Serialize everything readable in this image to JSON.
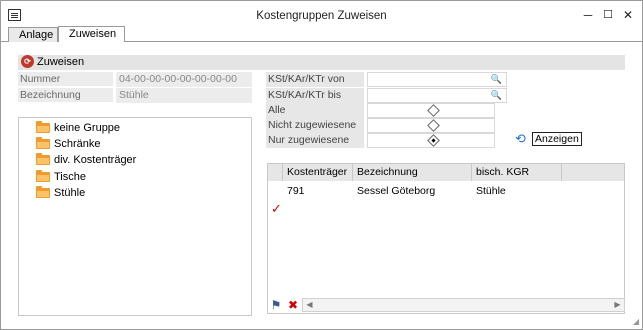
{
  "window": {
    "title": "Kostengruppen Zuweisen",
    "minimize": "─",
    "maximize": "☐",
    "close": "✕"
  },
  "tabs": [
    {
      "label": "Anlage"
    },
    {
      "label": "Zuweisen"
    }
  ],
  "header": {
    "label": "Zuweisen",
    "icon": "refresh-badge-icon"
  },
  "fields": {
    "nummer_label": "Nummer",
    "nummer_value": "04-00-00-00-00-00-00-00",
    "bezeichnung_label": "Bezeichnung",
    "bezeichnung_value": "Stühle"
  },
  "filters": {
    "von_label": "KSt/KAr/KTr von",
    "bis_label": "KSt/KAr/KTr bis",
    "alle_label": "Alle",
    "nicht_label": "Nicht zugewiesene",
    "nur_label": "Nur zugewiesene",
    "selected": "nur"
  },
  "tree": {
    "items": [
      {
        "label": "keine Gruppe"
      },
      {
        "label": "Schränke"
      },
      {
        "label": "div. Kostenträger"
      },
      {
        "label": "Tische"
      },
      {
        "label": "Stühle"
      }
    ]
  },
  "show_button": {
    "label": "Anzeigen"
  },
  "grid": {
    "columns": [
      "Kostenträger",
      "Bezeichnung",
      "bisch. KGR"
    ],
    "rows": [
      {
        "checked": true,
        "kostentraeger": "791",
        "bezeichnung": "Sessel Göteborg",
        "kgr": "Stühle"
      }
    ]
  },
  "icons": {
    "check": "✓",
    "delete": "✖",
    "scroll_left": "◀",
    "scroll_right": "▶"
  },
  "colors": {
    "accent_red": "#c0392b",
    "folder": "#f19a2e",
    "check_red": "#d40000"
  }
}
